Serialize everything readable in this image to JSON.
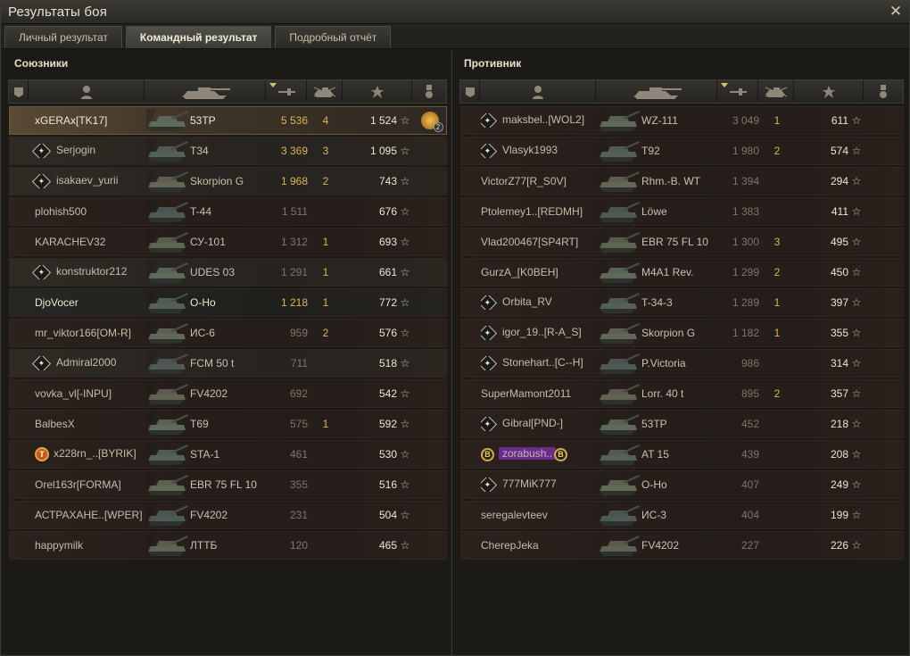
{
  "window": {
    "title": "Результаты боя"
  },
  "tabs": [
    {
      "label": "Личный результат"
    },
    {
      "label": "Командный результат"
    },
    {
      "label": "Подробный отчёт"
    }
  ],
  "allies": {
    "header": "Союзники",
    "rows": [
      {
        "name": "xGERAx[TK17]",
        "vehicle": "53TP",
        "damage": "5 536",
        "kills": "4",
        "xp": "1 524",
        "platoon": "",
        "medal_count": "2"
      },
      {
        "name": "Serjogin",
        "vehicle": "T34",
        "damage": "3 369",
        "kills": "3",
        "xp": "1 095",
        "platoon": "✦"
      },
      {
        "name": "isakaev_yurii",
        "vehicle": "Skorpion G",
        "damage": "1 968",
        "kills": "2",
        "xp": "743",
        "platoon": "✦"
      },
      {
        "name": "plohish500",
        "vehicle": "T-44",
        "damage": "1 511",
        "kills": "",
        "xp": "676",
        "platoon": ""
      },
      {
        "name": "KARACHEV32",
        "vehicle": "СУ-101",
        "damage": "1 312",
        "kills": "1",
        "xp": "693",
        "platoon": ""
      },
      {
        "name": "konstruktor212",
        "vehicle": "UDES 03",
        "damage": "1 291",
        "kills": "1",
        "xp": "661",
        "platoon": "✦"
      },
      {
        "name": "DjoVocer",
        "vehicle": "O-Ho",
        "damage": "1 218",
        "kills": "1",
        "xp": "772",
        "platoon": ""
      },
      {
        "name": "mr_viktor166[OM-R]",
        "vehicle": "ИС-6",
        "damage": "959",
        "kills": "2",
        "xp": "576",
        "platoon": ""
      },
      {
        "name": "Admiral2000",
        "vehicle": "FCM 50 t",
        "damage": "711",
        "kills": "",
        "xp": "518",
        "platoon": "✦"
      },
      {
        "name": "vovka_vl[-INPU]",
        "vehicle": "FV4202",
        "damage": "692",
        "kills": "",
        "xp": "542",
        "platoon": ""
      },
      {
        "name": "BalbesX",
        "vehicle": "T69",
        "damage": "575",
        "kills": "1",
        "xp": "592",
        "platoon": ""
      },
      {
        "name": "x228rn_..[BYRIK]",
        "vehicle": "STA-1",
        "damage": "461",
        "kills": "",
        "xp": "530",
        "platoon": "T"
      },
      {
        "name": "Orel163r[FORMA]",
        "vehicle": "EBR 75 FL 10",
        "damage": "355",
        "kills": "",
        "xp": "516",
        "platoon": ""
      },
      {
        "name": "АСТРАХАНЕ..[WPER]",
        "vehicle": "FV4202",
        "damage": "231",
        "kills": "",
        "xp": "504",
        "platoon": ""
      },
      {
        "name": "happymilk",
        "vehicle": "ЛТТБ",
        "damage": "120",
        "kills": "",
        "xp": "465",
        "platoon": ""
      }
    ]
  },
  "enemies": {
    "header": "Противник",
    "rows": [
      {
        "name": "maksbel..[WOL2]",
        "vehicle": "WZ-111",
        "damage": "3 049",
        "kills": "1",
        "xp": "611",
        "platoon": "✦"
      },
      {
        "name": "Vlasyk1993",
        "vehicle": "T92",
        "damage": "1 980",
        "kills": "2",
        "xp": "574",
        "platoon": "✦"
      },
      {
        "name": "VictorZ77[R_S0V]",
        "vehicle": "Rhm.-B. WT",
        "damage": "1 394",
        "kills": "",
        "xp": "294",
        "platoon": ""
      },
      {
        "name": "Ptolemey1..[REDMH]",
        "vehicle": "Löwe",
        "damage": "1 383",
        "kills": "",
        "xp": "411",
        "platoon": ""
      },
      {
        "name": "Vlad200467[SP4RT]",
        "vehicle": "EBR 75 FL 10",
        "damage": "1 300",
        "kills": "3",
        "xp": "495",
        "platoon": ""
      },
      {
        "name": "GurzA_[K0BEH]",
        "vehicle": "M4A1 Rev.",
        "damage": "1 299",
        "kills": "2",
        "xp": "450",
        "platoon": ""
      },
      {
        "name": "Orbita_RV",
        "vehicle": "T-34-3",
        "damage": "1 289",
        "kills": "1",
        "xp": "397",
        "platoon": "✦"
      },
      {
        "name": "igor_19..[R-A_S]",
        "vehicle": "Skorpion G",
        "damage": "1 182",
        "kills": "1",
        "xp": "355",
        "platoon": "✦"
      },
      {
        "name": "Stonehart..[C--H]",
        "vehicle": "P.Victoria",
        "damage": "986",
        "kills": "",
        "xp": "314",
        "platoon": "✦"
      },
      {
        "name": "SuperMamont2011",
        "vehicle": "Lorr. 40 t",
        "damage": "895",
        "kills": "2",
        "xp": "357",
        "platoon": ""
      },
      {
        "name": "Gibral[PND-]",
        "vehicle": "53TP",
        "damage": "452",
        "kills": "",
        "xp": "218",
        "platoon": "✦"
      },
      {
        "name": "zorabush..",
        "vehicle": "AT 15",
        "damage": "439",
        "kills": "",
        "xp": "208",
        "platoon": "B"
      },
      {
        "name": "777MiK777",
        "vehicle": "O-Ho",
        "damage": "407",
        "kills": "",
        "xp": "249",
        "platoon": "✦"
      },
      {
        "name": "seregalevteev",
        "vehicle": "ИС-3",
        "damage": "404",
        "kills": "",
        "xp": "199",
        "platoon": ""
      },
      {
        "name": "CherepJeka",
        "vehicle": "FV4202",
        "damage": "227",
        "kills": "",
        "xp": "226",
        "platoon": ""
      }
    ]
  },
  "icons": {
    "star": "☆",
    "close": "✕"
  },
  "colors": {
    "gold": "#d8b656",
    "platoon_border": "#c8c1ac",
    "badge_b": "#d4ad45"
  }
}
